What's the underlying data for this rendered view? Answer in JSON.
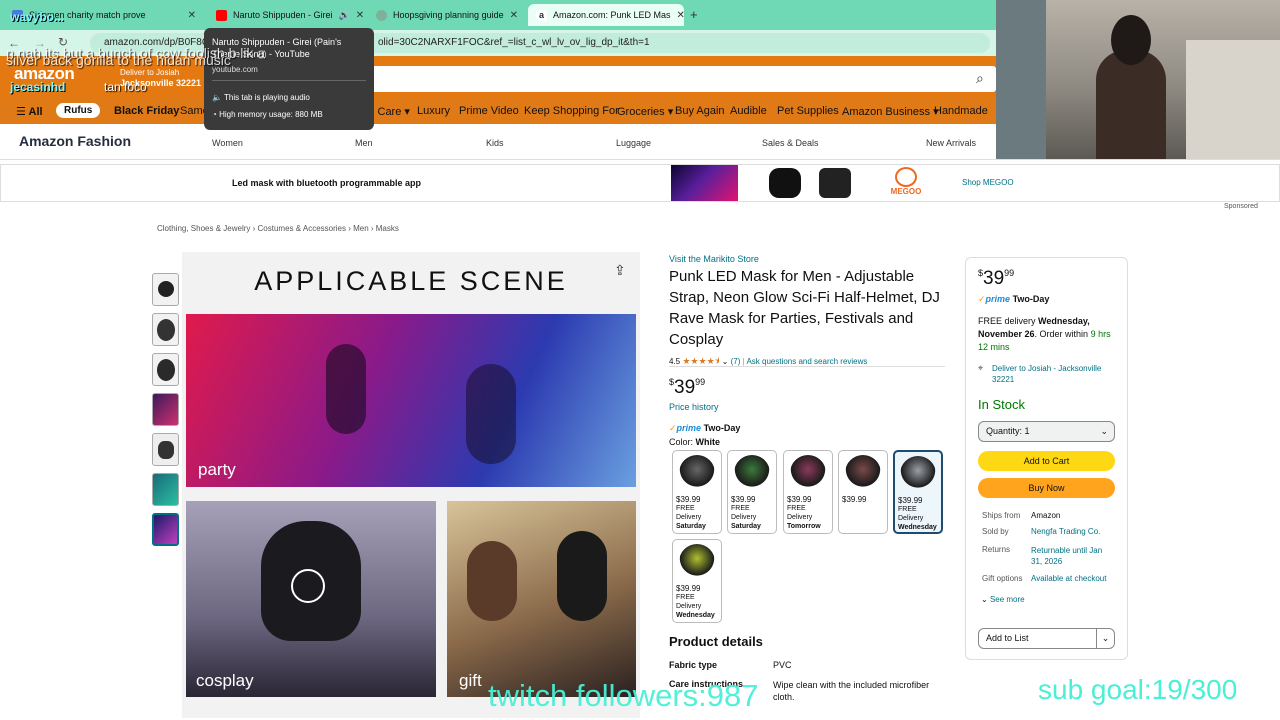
{
  "browser": {
    "tabs": [
      {
        "title": "Sidemen charity match prove",
        "color": "#4a7bd8"
      },
      {
        "title": "Naruto Shippuden - Girei",
        "color": "#ff0000"
      },
      {
        "title": "Hoopsgiving planning guide",
        "color": "#7fb09a"
      },
      {
        "title": "Amazon.com: Punk LED Mas",
        "color": "#232f3e"
      }
    ],
    "new_tab": "+",
    "url": "amazon.com/dp/B0F8QX...",
    "url_tail": "olid=30C2NARXF1FOC&ref_=list_c_wl_lv_ov_lig_dp_it&th=1"
  },
  "tooltip": {
    "title": "Naruto Shippuden - Girei (Pain's Theme Song) - YouTube",
    "domain": "youtube.com",
    "audio": "This tab is playing audio",
    "memory": "High memory usage: 880 MB"
  },
  "overlay_chat": {
    "user1": "wavybo...",
    "msg1": "n nah its but a bunch of cow foolish b lik a",
    "msg2": "silver back gorilla to the hidan music",
    "user2": "jecasinhd",
    "msg3": "tan foco"
  },
  "amazon": {
    "logo": "amazon",
    "deliver_label": "Deliver to Josiah",
    "deliver_location": "Jacksonville 32221",
    "nav": {
      "all": "All",
      "rufus": "Rufus",
      "items": [
        "Black Friday",
        "Same",
        "l Care ▾",
        "Luxury",
        "Prime Video",
        "Keep Shopping For",
        "Groceries ▾",
        "Buy Again",
        "Audible",
        "Pet Supplies",
        "Amazon Business ▾",
        "Handmade"
      ]
    },
    "fashion": {
      "title": "Amazon Fashion",
      "items": [
        "Women",
        "Men",
        "Kids",
        "Luggage",
        "Sales & Deals",
        "New Arrivals"
      ]
    },
    "ad": {
      "text": "Led mask with bluetooth programmable app",
      "brand": "MEGOO",
      "shop": "Shop MEGOO",
      "sponsored": "Sponsored"
    },
    "breadcrumb": [
      "Clothing, Shoes & Jewelry",
      "Costumes & Accessories",
      "Men",
      "Masks"
    ],
    "image": {
      "headline": "APPLICABLE SCENE",
      "scenes": [
        "party",
        "cosplay",
        "gift"
      ]
    },
    "product": {
      "store": "Visit the Marikito Store",
      "title": "Punk LED Mask for Men - Adjustable Strap, Neon Glow Sci-Fi Half-Helmet, DJ Rave Mask for Parties, Festivals and Cosplay",
      "rating": "4.5",
      "stars": 4.5,
      "reviews": "(7)",
      "qa": "Ask questions and search reviews",
      "price_symbol": "$",
      "price_whole": "39",
      "price_cents": "99",
      "price_history": "Price history",
      "prime": "prime",
      "prime_speed": "Two-Day",
      "color_label": "Color:",
      "color_value": "White",
      "variants": [
        {
          "price": "$39.99",
          "d1": "FREE Delivery",
          "d2": "Saturday"
        },
        {
          "price": "$39.99",
          "d1": "FREE Delivery",
          "d2": "Saturday"
        },
        {
          "price": "$39.99",
          "d1": "FREE Delivery",
          "d2": "Tomorrow"
        },
        {
          "price": "$39.99",
          "d1": "",
          "d2": ""
        },
        {
          "price": "$39.99",
          "d1": "FREE Delivery",
          "d2": "Wednesday"
        },
        {
          "price": "$39.99",
          "d1": "FREE Delivery",
          "d2": "Wednesday"
        }
      ],
      "details_title": "Product details",
      "details": [
        {
          "k": "Fabric type",
          "v": "PVC"
        },
        {
          "k": "Care instructions",
          "v": "Wipe clean with the included microfiber cloth."
        }
      ]
    },
    "buybox": {
      "price_symbol": "$",
      "price_whole": "39",
      "price_cents": "99",
      "prime": "prime",
      "prime_speed": "Two-Day",
      "delivery_pre": "FREE delivery ",
      "delivery_date": "Wednesday, November 26",
      "delivery_mid": ". Order within ",
      "delivery_time": "9 hrs 12 mins",
      "deliver_to": "Deliver to Josiah - Jacksonville 32221",
      "stock": "In Stock",
      "quantity": "Quantity:  1",
      "add_to_cart": "Add to Cart",
      "buy_now": "Buy Now",
      "ships_from_label": "Ships from",
      "ships_from": "Amazon",
      "sold_by_label": "Sold by",
      "sold_by": "Nengfa Trading Co.",
      "returns_label": "Returns",
      "returns": "Returnable until Jan 31, 2026",
      "gift_label": "Gift options",
      "gift": "Available at checkout",
      "see_more": "See more",
      "add_to_list": "Add to List"
    }
  },
  "stream": {
    "followers": "twitch followers:987",
    "sub_goal": "sub goal:19/300"
  },
  "colors": {
    "tabbar": "#6fd8b4",
    "amazon_orange": "#e47911",
    "link": "#007185",
    "in_stock": "#007600",
    "add_to_cart": "#ffd814",
    "buy_now": "#ffa41c",
    "stream_overlay": "#49f0d6"
  }
}
